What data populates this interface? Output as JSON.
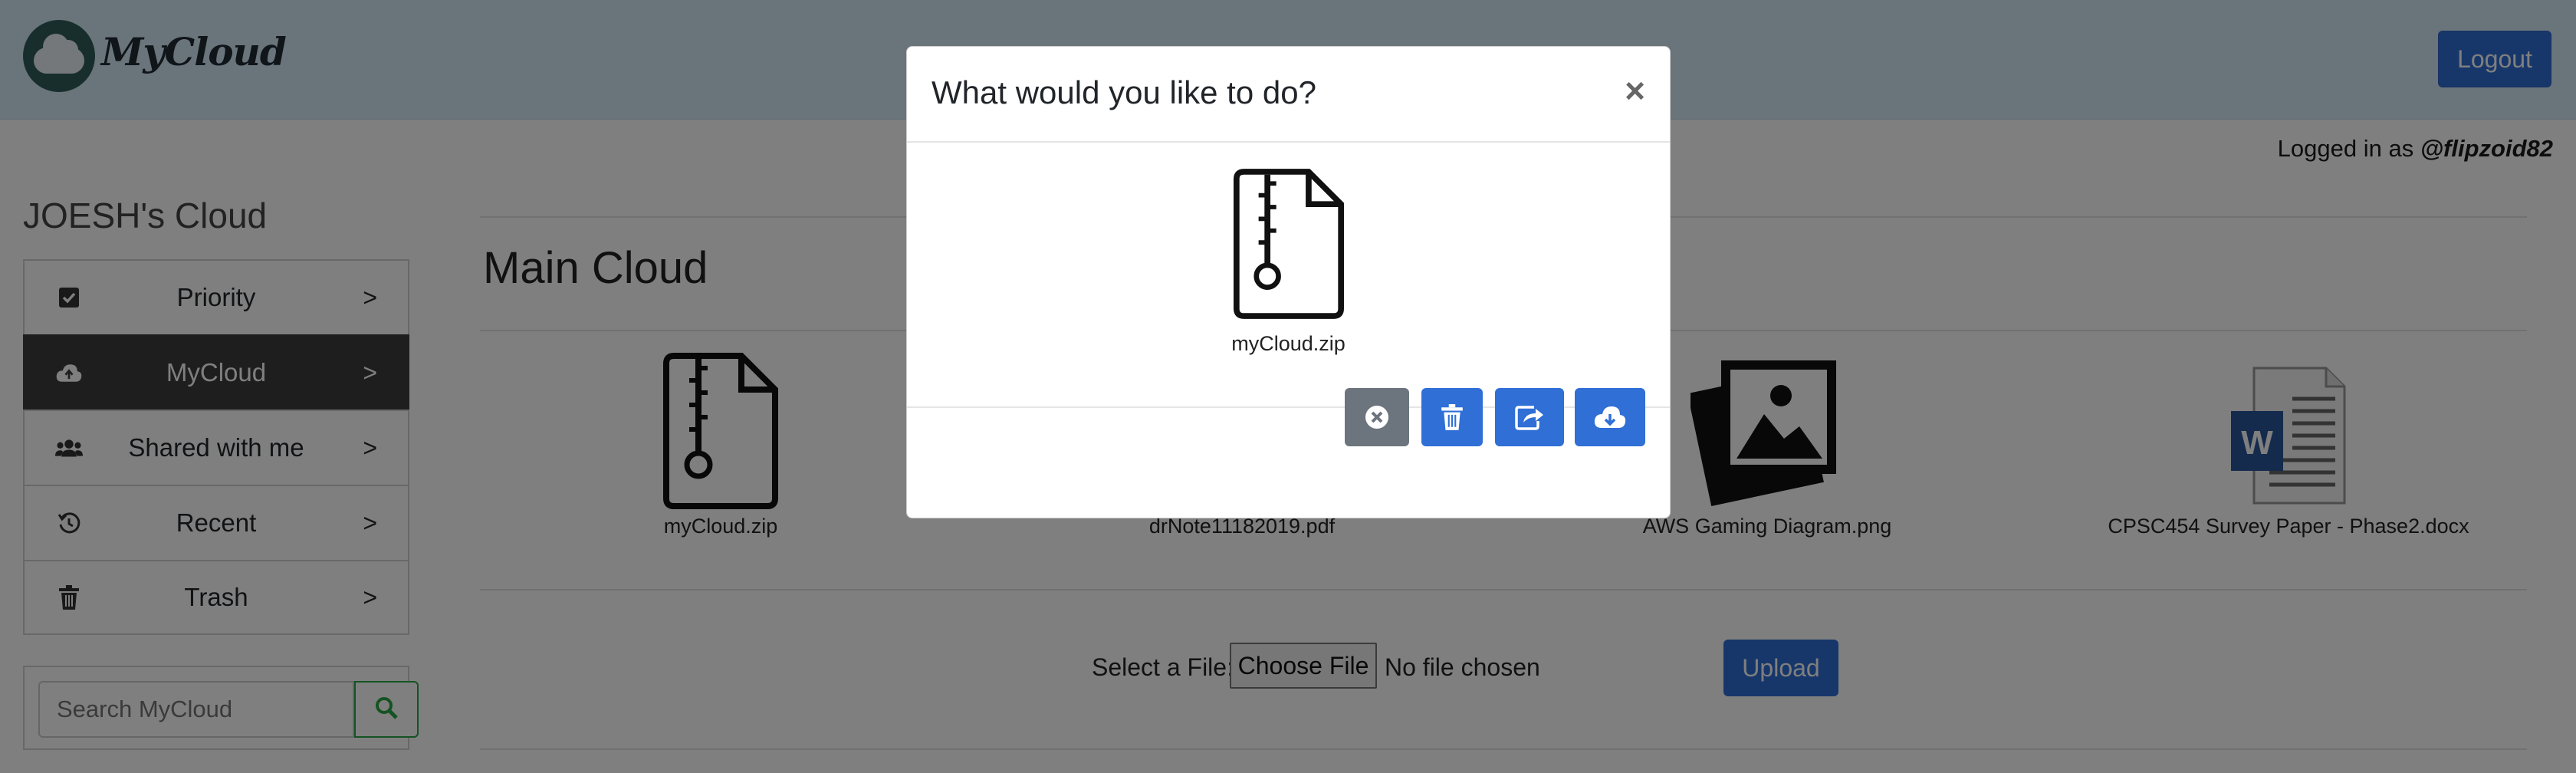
{
  "app": {
    "brand": "MyCloud",
    "logout_label": "Logout"
  },
  "user": {
    "logged_in_prefix": "Logged in as ",
    "handle": "@flipzoid82"
  },
  "sidebar": {
    "title": "JOESH's Cloud",
    "items": [
      {
        "label": "Priority",
        "icon": "checkbox-icon",
        "arrow": ">"
      },
      {
        "label": "MyCloud",
        "icon": "cloud-upload-icon",
        "arrow": ">",
        "active": true
      },
      {
        "label": "Shared with me",
        "icon": "users-icon",
        "arrow": ">"
      },
      {
        "label": "Recent",
        "icon": "history-icon",
        "arrow": ">"
      },
      {
        "label": "Trash",
        "icon": "trash-icon",
        "arrow": ">"
      }
    ],
    "search_placeholder": "Search MyCloud"
  },
  "main": {
    "title": "Main Cloud",
    "files": [
      {
        "name": "myCloud.zip",
        "icon": "zip-file-icon"
      },
      {
        "name": "drNote11182019.pdf",
        "icon": "pdf-file-icon"
      },
      {
        "name": "AWS Gaming Diagram.png",
        "icon": "image-file-icon"
      },
      {
        "name": "CPSC454 Survey Paper - Phase2.docx",
        "icon": "word-file-icon"
      }
    ],
    "upload": {
      "select_label": "Select a File:",
      "choose_label": "Choose File",
      "no_file_label": "No file chosen",
      "upload_label": "Upload"
    }
  },
  "modal": {
    "title": "What would you like to do?",
    "close_symbol": "×",
    "file_name": "myCloud.zip",
    "actions": [
      {
        "name": "cancel",
        "icon": "close-circle-icon",
        "color": "#6c757d"
      },
      {
        "name": "delete",
        "icon": "trash-icon",
        "color": "#2f6fd6"
      },
      {
        "name": "share",
        "icon": "share-icon",
        "color": "#2f6fd6"
      },
      {
        "name": "download",
        "icon": "cloud-download-icon",
        "color": "#2f6fd6"
      }
    ]
  }
}
